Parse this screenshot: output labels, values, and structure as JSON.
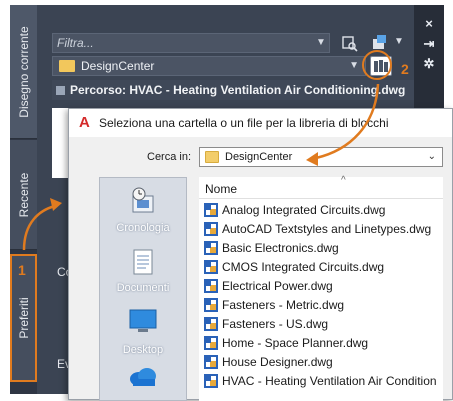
{
  "palette": {
    "tabs": [
      {
        "label": "Disegno corrente"
      },
      {
        "label": "Recente"
      },
      {
        "label": "Preferiti"
      }
    ],
    "strip_buttons": [
      "×",
      "⇥",
      "✲"
    ],
    "filter_placeholder": "Filtra...",
    "folder": "DesignCenter",
    "path": "Percorso: HVAC - Heating Ventilation Air Conditioning.dwg",
    "side_fragments": [
      "Co",
      "Ev"
    ],
    "callout_numbers": [
      "1",
      "2"
    ]
  },
  "dialog": {
    "title": "Seleziona una cartella o un file per la libreria di blocchi",
    "lookin_label": "Cerca in:",
    "lookin_value": "DesignCenter",
    "places": [
      {
        "label": "Cronologia",
        "icon": "history-icon"
      },
      {
        "label": "Documenti",
        "icon": "documents-icon"
      },
      {
        "label": "Desktop",
        "icon": "desktop-icon"
      },
      {
        "label": "",
        "icon": "onedrive-cloud-icon"
      }
    ],
    "column_header": "Nome",
    "files": [
      "Analog Integrated Circuits.dwg",
      "AutoCAD Textstyles and Linetypes.dwg",
      "Basic Electronics.dwg",
      "CMOS Integrated Circuits.dwg",
      "Electrical Power.dwg",
      "Fasteners - Metric.dwg",
      "Fasteners - US.dwg",
      "Home - Space Planner.dwg",
      "House Designer.dwg",
      "HVAC - Heating Ventilation Air Condition"
    ]
  },
  "colors": {
    "highlight": "#e07b1f",
    "palette_bg": "#3b4453",
    "folder": "#f3cd6a"
  }
}
